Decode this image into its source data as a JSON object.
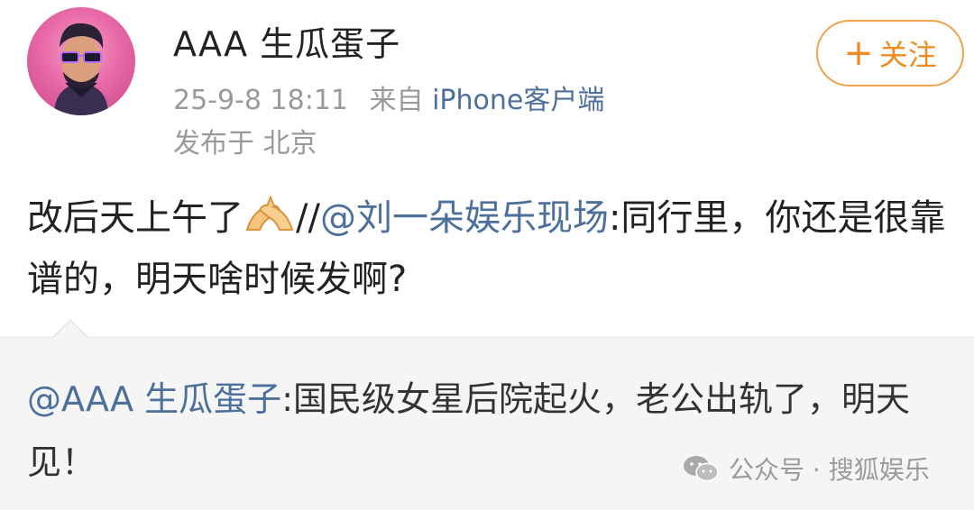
{
  "post": {
    "username": "AAA 生瓜蛋子",
    "timestamp": "25-9-8 18:11",
    "source_prefix": "来自",
    "client": "iPhone客户端",
    "location": "发布于 北京",
    "follow_plus": "+",
    "follow_label": "关注",
    "text_before": "改后天上午了",
    "text_sep": "//",
    "mention": "@刘一朵娱乐现场",
    "text_after": ":同行里，你还是很靠谱的，明天啥时候发啊?"
  },
  "repost": {
    "mention": "@AAA 生瓜蛋子",
    "text": ":国民级女星后院起火，老公出轨了，明天见！"
  },
  "watermark": {
    "text": "公众号 · 搜狐娱乐"
  },
  "icons": {
    "avatar": "avatar-cartoon-man-sunglasses",
    "emoji": "pinched-hands-emoji",
    "watermark_icon": "wechat-icon"
  },
  "colors": {
    "link": "#4c6f9b",
    "follow_accent": "#f08a1e",
    "meta_gray": "#999999",
    "repost_bg": "#f5f5f5"
  }
}
